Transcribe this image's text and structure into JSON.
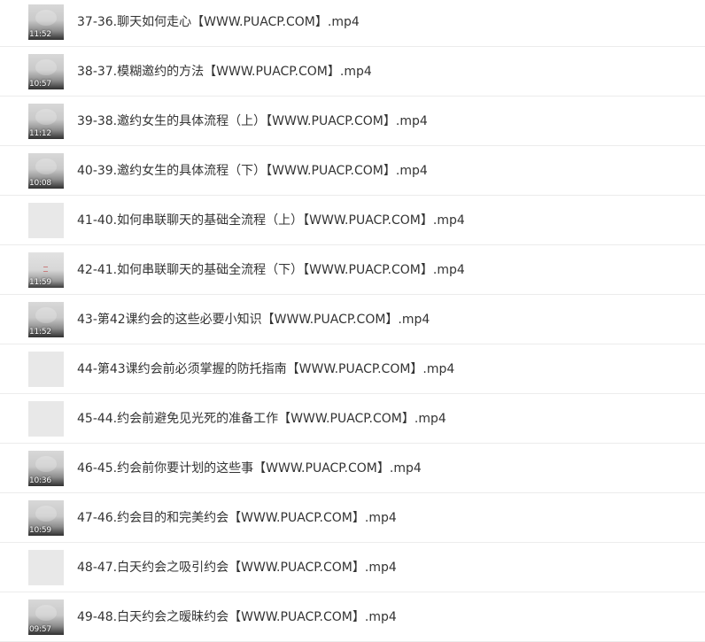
{
  "files": [
    {
      "name": "37-36.聊天如何走心【WWW.PUACP.COM】.mp4",
      "duration": "11:52",
      "thumbnail": "video"
    },
    {
      "name": "38-37.模糊邀约的方法【WWW.PUACP.COM】.mp4",
      "duration": "10:57",
      "thumbnail": "video"
    },
    {
      "name": "39-38.邀约女生的具体流程（上）【WWW.PUACP.COM】.mp4",
      "duration": "11:12",
      "thumbnail": "video"
    },
    {
      "name": "40-39.邀约女生的具体流程（下）【WWW.PUACP.COM】.mp4",
      "duration": "10:08",
      "thumbnail": "video"
    },
    {
      "name": "41-40.如何串联聊天的基础全流程（上）【WWW.PUACP.COM】.mp4",
      "duration": "",
      "thumbnail": "blank"
    },
    {
      "name": "42-41.如何串联聊天的基础全流程（下）【WWW.PUACP.COM】.mp4",
      "duration": "11:59",
      "thumbnail": "broken"
    },
    {
      "name": "43-第42课约会的这些必要小知识【WWW.PUACP.COM】.mp4",
      "duration": "11:52",
      "thumbnail": "video"
    },
    {
      "name": "44-第43课约会前必须掌握的防托指南【WWW.PUACP.COM】.mp4",
      "duration": "",
      "thumbnail": "blank"
    },
    {
      "name": "45-44.约会前避免见光死的准备工作【WWW.PUACP.COM】.mp4",
      "duration": "",
      "thumbnail": "blank"
    },
    {
      "name": "46-45.约会前你要计划的这些事【WWW.PUACP.COM】.mp4",
      "duration": "10:36",
      "thumbnail": "video"
    },
    {
      "name": "47-46.约会目的和完美约会【WWW.PUACP.COM】.mp4",
      "duration": "10:59",
      "thumbnail": "video"
    },
    {
      "name": "48-47.白天约会之吸引约会【WWW.PUACP.COM】.mp4",
      "duration": "",
      "thumbnail": "blank"
    },
    {
      "name": "49-48.白天约会之暧昧约会【WWW.PUACP.COM】.mp4",
      "duration": "09:57",
      "thumbnail": "video"
    }
  ],
  "colors": {
    "text": "#333333",
    "divider": "#ececec",
    "placeholder": "#e8e8e8",
    "background": "#ffffff"
  }
}
